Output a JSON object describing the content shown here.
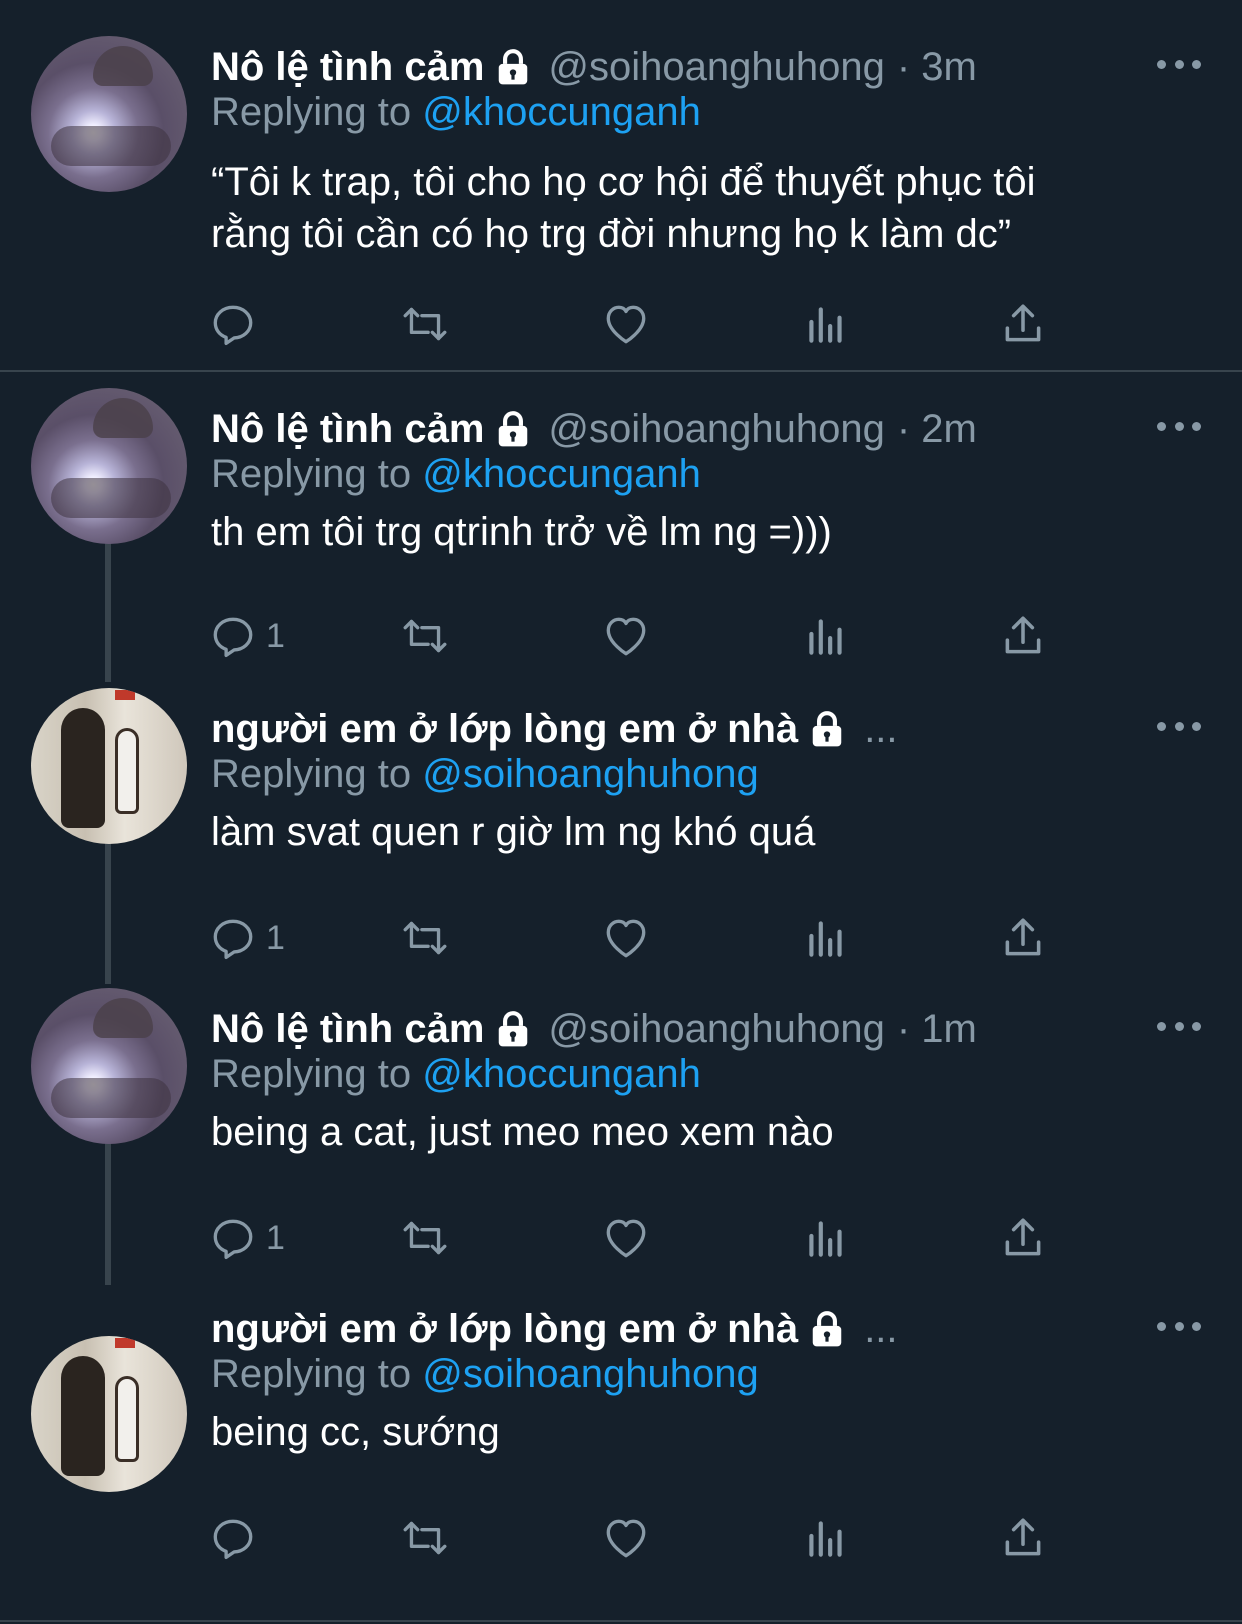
{
  "tweets": [
    {
      "name": "Nô lệ tình cảm",
      "handle": "@soihoanghuhong",
      "time": "· 3m",
      "replying_prefix": "Replying to",
      "replying_to": "@khoccunganh",
      "text_lines": [
        "“Tôi k trap, tôi cho họ cơ hội để thuyết phục tôi",
        "rằng tôi cần có họ trg đời nhưng họ k làm dc”"
      ],
      "reply_count": ""
    },
    {
      "name": "Nô lệ tình cảm",
      "handle": "@soihoanghuhong",
      "time": "· 2m",
      "replying_prefix": "Replying to",
      "replying_to": "@khoccunganh",
      "text_lines": [
        "th em tôi trg qtrinh trở về lm ng =)))"
      ],
      "reply_count": "1"
    },
    {
      "name": "người em ở lớp lòng em ở nhà",
      "ellipsis": "...",
      "replying_prefix": "Replying to",
      "replying_to": "@soihoanghuhong",
      "text_lines": [
        "làm svat quen r giờ lm ng khó quá"
      ],
      "reply_count": "1"
    },
    {
      "name": "Nô lệ tình cảm",
      "handle": "@soihoanghuhong",
      "time": "· 1m",
      "replying_prefix": "Replying to",
      "replying_to": "@khoccunganh",
      "text_lines": [
        "being a cat, just meo meo xem nào"
      ],
      "reply_count": "1"
    },
    {
      "name": "người em ở lớp lòng em ở nhà",
      "ellipsis": "...",
      "replying_prefix": "Replying to",
      "replying_to": "@soihoanghuhong",
      "text_lines": [
        "being cc, sướng"
      ],
      "reply_count": ""
    }
  ],
  "icons": [
    "reply-icon",
    "retweet-icon",
    "like-icon",
    "analytics-icon",
    "share-icon",
    "lock-icon",
    "more-icon"
  ],
  "colors": {
    "background": "#15202b",
    "text": "#ffffff",
    "muted": "#8899a6",
    "link": "#1da1f2",
    "divider": "#38444d"
  }
}
